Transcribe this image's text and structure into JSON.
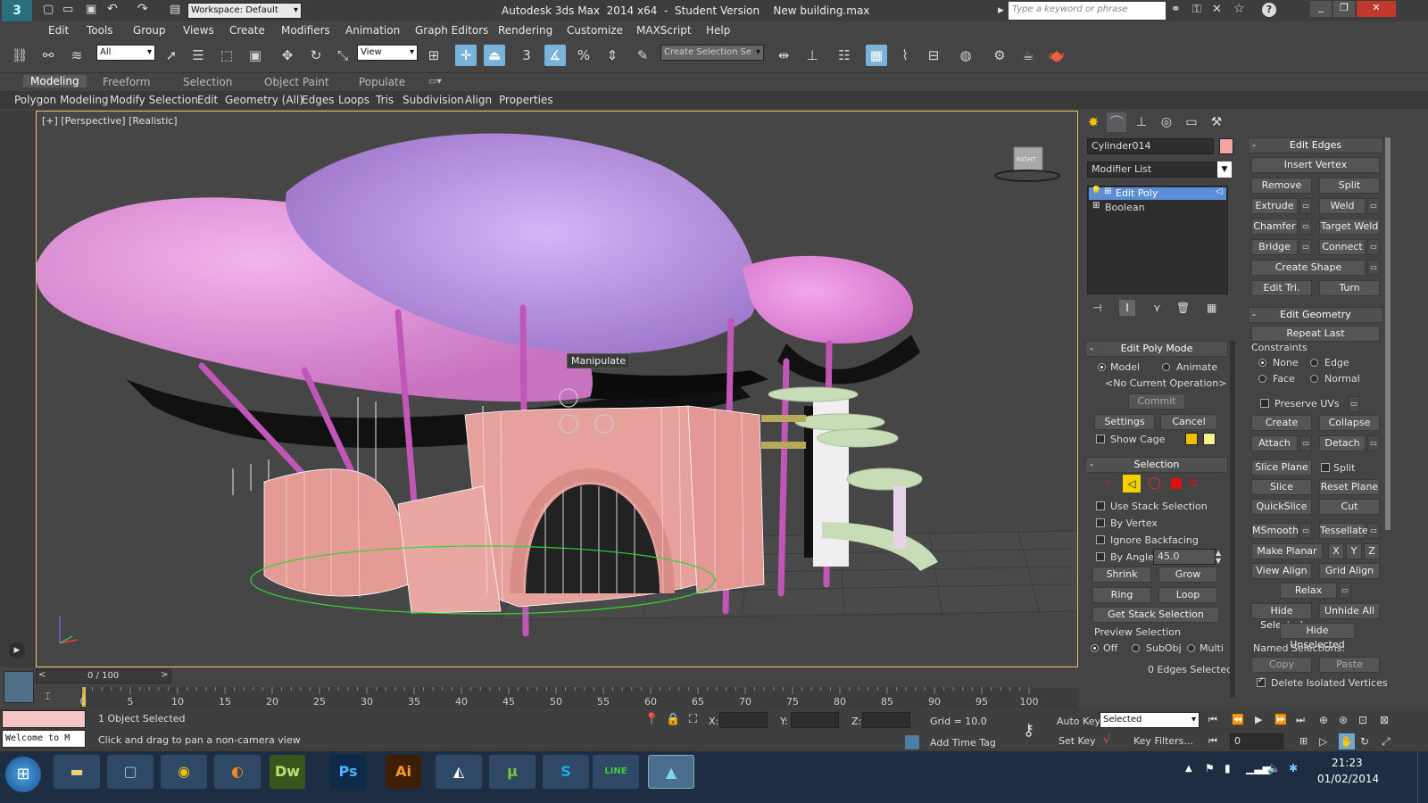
{
  "title_bar": {
    "workspace": "Workspace: Default",
    "title": "Autodesk 3ds Max  2014 x64  -  Student Version    New building.max",
    "search_placeholder": "Type a keyword or phrase"
  },
  "menu": [
    "Edit",
    "Tools",
    "Group",
    "Views",
    "Create",
    "Modifiers",
    "Animation",
    "Graph Editors",
    "Rendering",
    "Customize",
    "MAXScript",
    "Help"
  ],
  "toolbar": {
    "filter_value": "All",
    "ref_coord_value": "View",
    "snap_value": "3",
    "selection_set_placeholder": "Create Selection Se"
  },
  "ribbon": {
    "tabs": [
      "Modeling",
      "Freeform",
      "Selection",
      "Object Paint",
      "Populate"
    ],
    "items": [
      "Polygon Modeling",
      "Modify Selection",
      "Edit",
      "Geometry (All)",
      "Edges",
      "Loops",
      "Tris",
      "Subdivision",
      "Align",
      "Properties"
    ]
  },
  "viewport": {
    "label": "[+] [Perspective] [Realistic]",
    "tooltip": "Manipulate",
    "viewcube_label": "RIGHT"
  },
  "command_panel": {
    "object_name": "Cylinder014",
    "object_color": "#f2a3a3",
    "modifier_list_label": "Modifier List",
    "stack": [
      "Edit Poly",
      "Boolean"
    ],
    "edit_poly_mode": {
      "title": "Edit Poly Mode",
      "model": "Model",
      "animate": "Animate",
      "operation": "<No Current Operation>",
      "commit": "Commit",
      "settings": "Settings",
      "cancel": "Cancel",
      "show_cage": "Show Cage"
    },
    "selection": {
      "title": "Selection",
      "use_stack_selection": "Use Stack Selection",
      "by_vertex": "By Vertex",
      "ignore_backfacing": "Ignore Backfacing",
      "by_angle": "By Angle:",
      "angle_value": "45.0",
      "shrink": "Shrink",
      "grow": "Grow",
      "ring": "Ring",
      "loop": "Loop",
      "get_stack_selection": "Get Stack Selection",
      "preview_selection": "Preview Selection",
      "off": "Off",
      "subobj": "SubObj",
      "multi": "Multi",
      "edges_selected": "0 Edges Selected"
    }
  },
  "edit_edges": {
    "title": "Edit Edges",
    "insert_vertex": "Insert Vertex",
    "remove": "Remove",
    "split": "Split",
    "extrude": "Extrude",
    "weld": "Weld",
    "chamfer": "Chamfer",
    "target_weld": "Target Weld",
    "bridge": "Bridge",
    "connect": "Connect",
    "create_shape": "Create Shape",
    "edit_tri": "Edit Tri.",
    "turn": "Turn"
  },
  "edit_geometry": {
    "title": "Edit Geometry",
    "repeat_last": "Repeat Last",
    "constraints": "Constraints",
    "none": "None",
    "edge": "Edge",
    "face": "Face",
    "normal": "Normal",
    "preserve_uvs": "Preserve UVs",
    "create": "Create",
    "collapse": "Collapse",
    "attach": "Attach",
    "detach": "Detach",
    "slice_plane": "Slice Plane",
    "split": "Split",
    "slice": "Slice",
    "reset_plane": "Reset Plane",
    "quickslice": "QuickSlice",
    "cut": "Cut",
    "msmooth": "MSmooth",
    "tessellate": "Tessellate",
    "make_planar": "Make Planar",
    "x": "X",
    "y": "Y",
    "z": "Z",
    "view_align": "View Align",
    "grid_align": "Grid Align",
    "relax": "Relax",
    "hide_selected": "Hide Selected",
    "unhide_all": "Unhide All",
    "hide_unselected": "Hide Unselected",
    "named_selections": "Named Selections:",
    "copy": "Copy",
    "paste": "Paste",
    "delete_isolated": "Delete Isolated Vertices"
  },
  "timeline": {
    "frame_counter": "0 / 100",
    "ticks": [
      "0",
      "5",
      "10",
      "15",
      "20",
      "25",
      "30",
      "35",
      "40",
      "45",
      "50",
      "55",
      "60",
      "65",
      "70",
      "75",
      "80",
      "85",
      "90",
      "95",
      "100"
    ]
  },
  "status": {
    "maxscript": "Welcome to M",
    "selected": "1 Object Selected",
    "prompt": "Click and drag to pan a non-camera view",
    "x_label": "X:",
    "y_label": "Y:",
    "z_label": "Z:",
    "grid": "Grid = 10.0",
    "add_time_tag": "Add Time Tag",
    "auto_key": "Auto Key",
    "set_key": "Set Key",
    "selected_dropdown": "Selected",
    "key_filters": "Key Filters...",
    "frame_value": "0"
  },
  "taskbar": {
    "time": "21:23",
    "date": "01/02/2014",
    "apps": [
      "explorer",
      "files",
      "chrome",
      "firefox",
      "Dw",
      "Ps",
      "Ai",
      "unity",
      "utorrent",
      "S",
      "LINE",
      "max"
    ]
  }
}
